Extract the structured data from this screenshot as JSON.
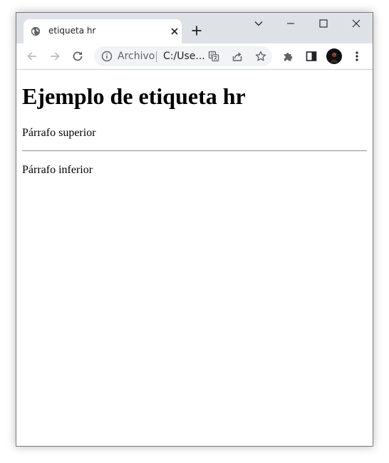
{
  "tab": {
    "title": "etiqueta hr"
  },
  "omnibox": {
    "security_label": "Archivo",
    "url": "C:/Use..."
  },
  "page": {
    "heading": "Ejemplo de etiqueta hr",
    "paragraph_top": "Párrafo superior",
    "paragraph_bottom": "Párrafo inferior"
  },
  "colors": {
    "titlebar_bg": "#dee1e6",
    "omnibox_bg": "#f1f3f4",
    "icon_color": "#5f6368",
    "hr_color": "#9a9a9a"
  },
  "icons": {
    "tab_favicon": "globe-icon",
    "tab_close": "close-icon",
    "new_tab": "plus-icon",
    "tab_search": "chevron-down-icon",
    "minimize": "minimize-icon",
    "maximize": "maximize-icon",
    "close_window": "close-icon",
    "back": "arrow-left-icon",
    "forward": "arrow-right-icon",
    "reload": "reload-icon",
    "site_info": "info-icon",
    "translate": "translate-icon",
    "share": "share-icon",
    "bookmark": "star-icon",
    "extensions": "puzzle-icon",
    "side_panel": "side-panel-icon",
    "profile": "avatar",
    "menu": "kebab-menu-icon"
  }
}
